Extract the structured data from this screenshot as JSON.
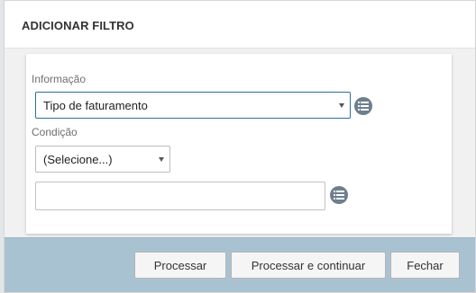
{
  "dialog": {
    "title": "ADICIONAR FILTRO"
  },
  "form": {
    "info_label": "Informação",
    "info_value": "Tipo de faturamento",
    "condition_label": "Condição",
    "condition_value": "(Selecione...)",
    "text_value": "",
    "list_icon": "list-icon"
  },
  "footer": {
    "process_label": "Processar",
    "process_continue_label": "Processar e continuar",
    "close_label": "Fechar"
  },
  "colors": {
    "footer_bg": "#a9c2d2",
    "active_border": "#2c6fa0",
    "icon_bg": "#6e7f8d"
  }
}
